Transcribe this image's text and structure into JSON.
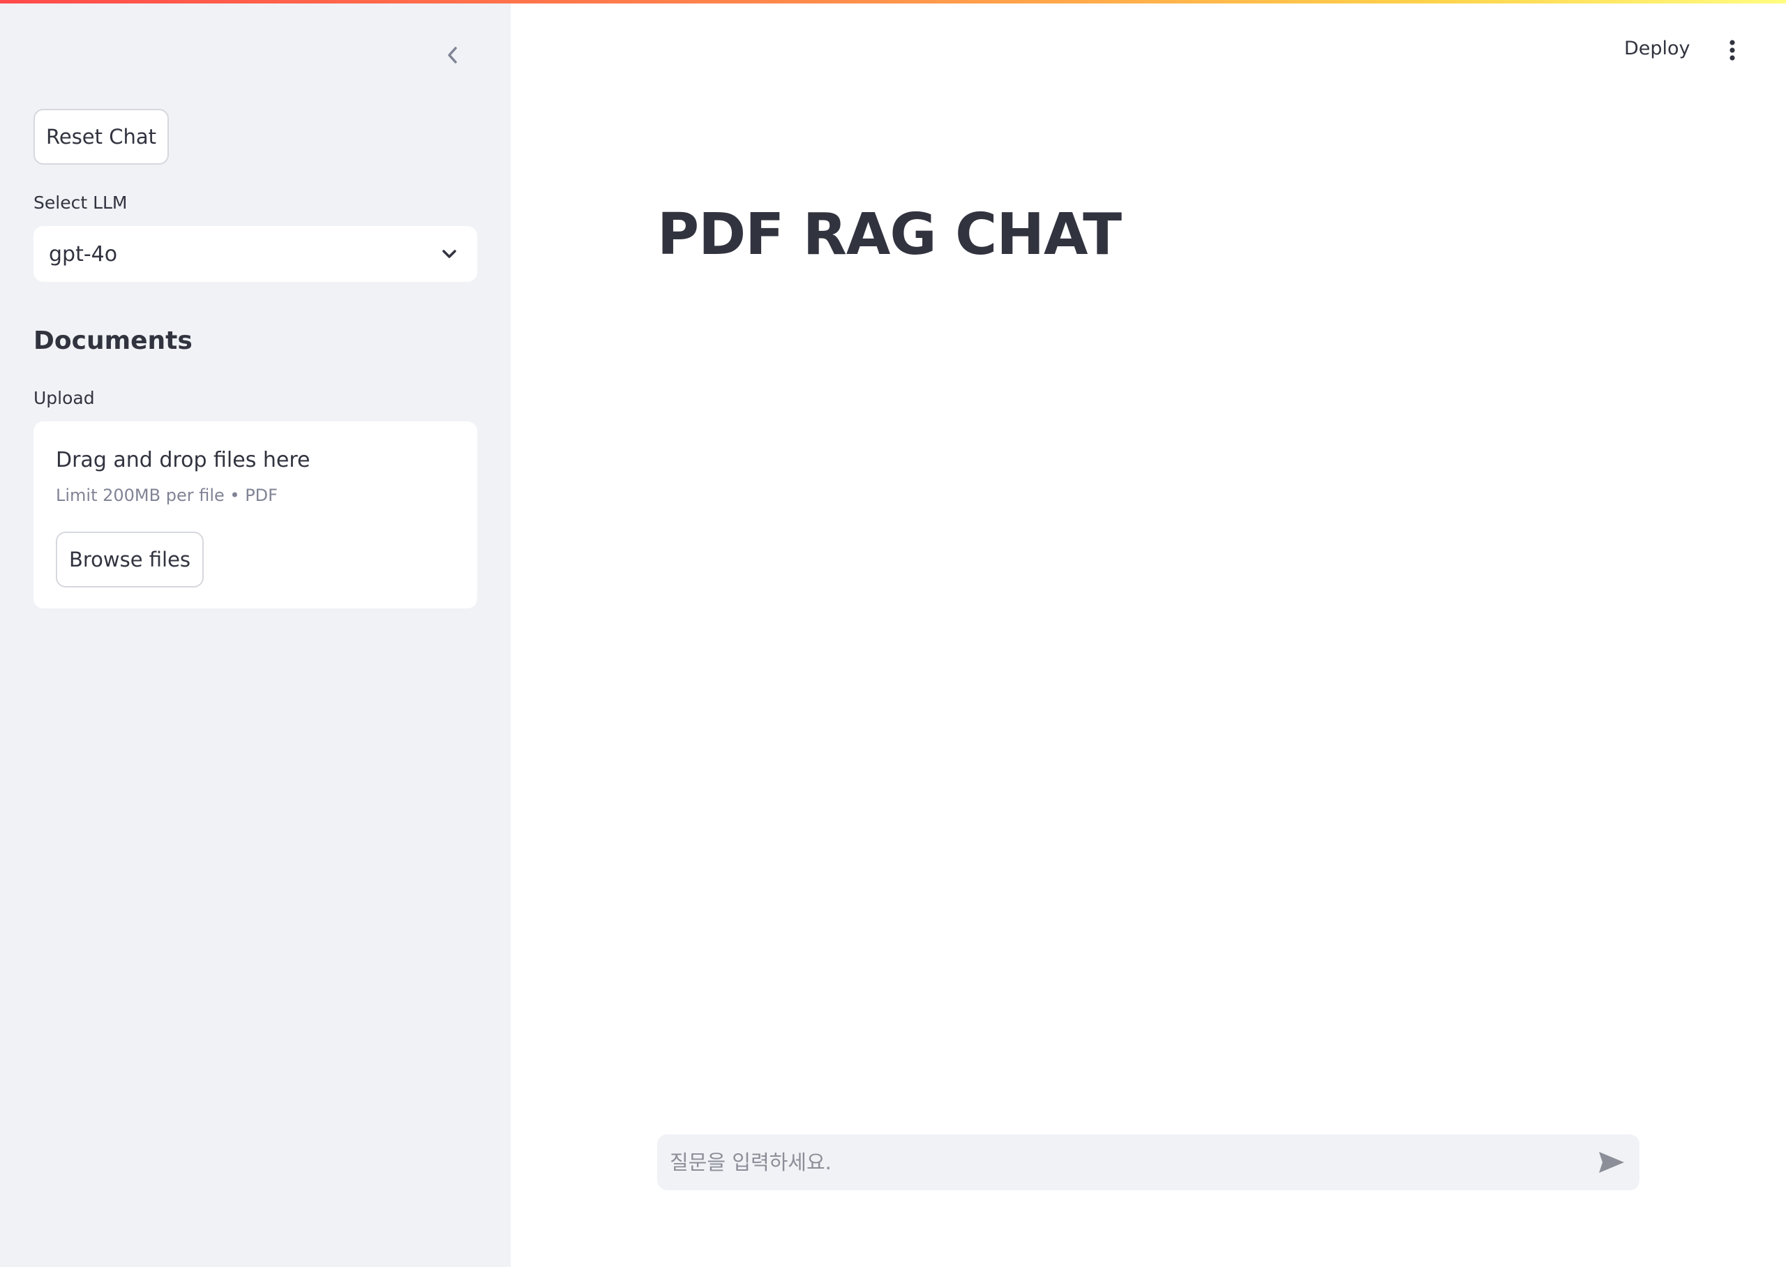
{
  "sidebar": {
    "collapse_icon": "chevron-left-icon",
    "reset_label": "Reset Chat",
    "select_label": "Select LLM",
    "select_value": "gpt-4o",
    "documents_heading": "Documents",
    "upload_label": "Upload",
    "dropzone": {
      "title": "Drag and drop files here",
      "limit": "Limit 200MB per file • PDF",
      "browse_label": "Browse files"
    }
  },
  "header": {
    "deploy_label": "Deploy",
    "menu_icon": "more-vertical-icon"
  },
  "main": {
    "title": "PDF RAG CHAT",
    "chat_placeholder": "질문을 입력하세요.",
    "send_icon": "send-icon"
  },
  "colors": {
    "sidebar_bg": "#f0f2f6",
    "text": "#31333f",
    "muted": "#808495",
    "gradient": [
      "#ff4b4b",
      "#ffd24b",
      "#fffd80"
    ]
  }
}
